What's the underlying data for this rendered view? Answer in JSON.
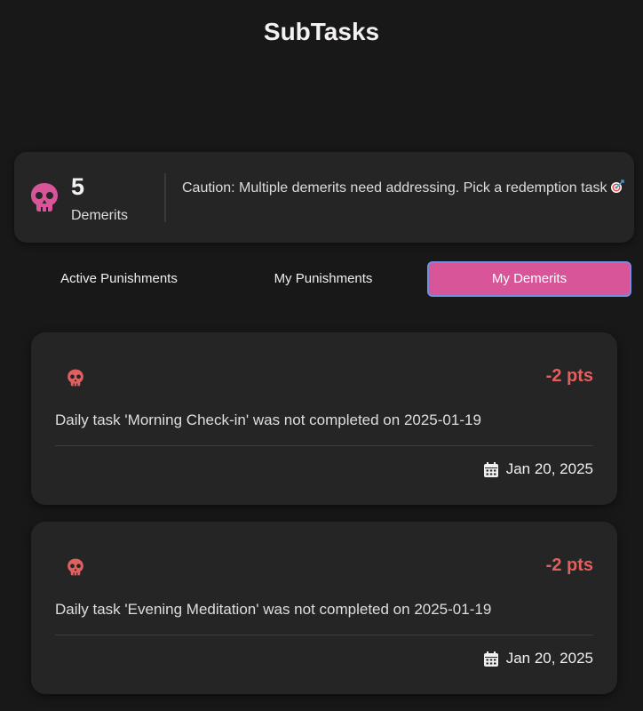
{
  "header": {
    "title": "SubTasks"
  },
  "summary": {
    "count": "5",
    "count_label": "Demerits",
    "message": "Caution: Multiple demerits need addressing. Pick a redemption task"
  },
  "tabs": [
    {
      "label": "Active Punishments",
      "active": false
    },
    {
      "label": "My Punishments",
      "active": false
    },
    {
      "label": "My Demerits",
      "active": true
    }
  ],
  "demerits": [
    {
      "points": "-2 pts",
      "description": "Daily task 'Morning Check-in' was not completed on 2025-01-19",
      "date": "Jan 20, 2025"
    },
    {
      "points": "-2 pts",
      "description": "Daily task 'Evening Meditation' was not completed on 2025-01-19",
      "date": "Jan 20, 2025"
    }
  ],
  "colors": {
    "background": "#181818",
    "card": "#252525",
    "accent_pink": "#d9559a",
    "points_red": "#e06060",
    "tab_border": "#6f8fe0"
  },
  "icons": {
    "summary": "skull-icon",
    "card": "skull-icon",
    "date": "calendar-icon",
    "message": "target-icon"
  }
}
